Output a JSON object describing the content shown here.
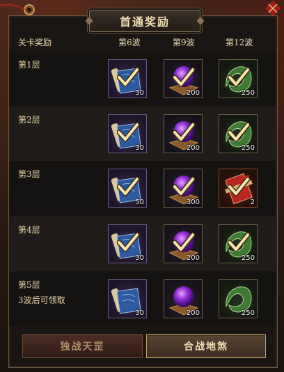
{
  "title": "首通奖励",
  "columns": {
    "label": "关卡奖励",
    "wave6": "第6波",
    "wave9": "第9波",
    "wave12": "第12波"
  },
  "rows": [
    {
      "label": "第1层",
      "sub": "",
      "rewards": [
        {
          "type": "book-icon",
          "qty": "30",
          "claimed": true
        },
        {
          "type": "orb-icon",
          "qty": "200",
          "claimed": true
        },
        {
          "type": "leaf-icon",
          "qty": "250",
          "claimed": true
        }
      ]
    },
    {
      "label": "第2层",
      "sub": "",
      "rewards": [
        {
          "type": "book-icon",
          "qty": "30",
          "claimed": true
        },
        {
          "type": "orb-icon",
          "qty": "200",
          "claimed": true
        },
        {
          "type": "leaf-icon",
          "qty": "250",
          "claimed": true
        }
      ]
    },
    {
      "label": "第3层",
      "sub": "",
      "rewards": [
        {
          "type": "book-icon",
          "qty": "50",
          "claimed": true
        },
        {
          "type": "orb-icon",
          "qty": "300",
          "claimed": true
        },
        {
          "type": "scroll-icon",
          "qty": "2",
          "claimed": true
        }
      ]
    },
    {
      "label": "第4层",
      "sub": "",
      "rewards": [
        {
          "type": "book-icon",
          "qty": "30",
          "claimed": true
        },
        {
          "type": "orb-icon",
          "qty": "200",
          "claimed": true
        },
        {
          "type": "leaf-icon",
          "qty": "250",
          "claimed": true
        }
      ]
    },
    {
      "label": "第5层",
      "sub": "3波后可领取",
      "rewards": [
        {
          "type": "book-icon",
          "qty": "30",
          "claimed": false
        },
        {
          "type": "orb-icon",
          "qty": "200",
          "claimed": false
        },
        {
          "type": "leaf-icon",
          "qty": "250",
          "claimed": false
        }
      ]
    }
  ],
  "buttons": {
    "left": "独战天罡",
    "right": "合战地煞"
  },
  "colors": {
    "gold_text": "#efdfb6",
    "check": "#f5e6b0",
    "active_border": "#c7a56b"
  }
}
